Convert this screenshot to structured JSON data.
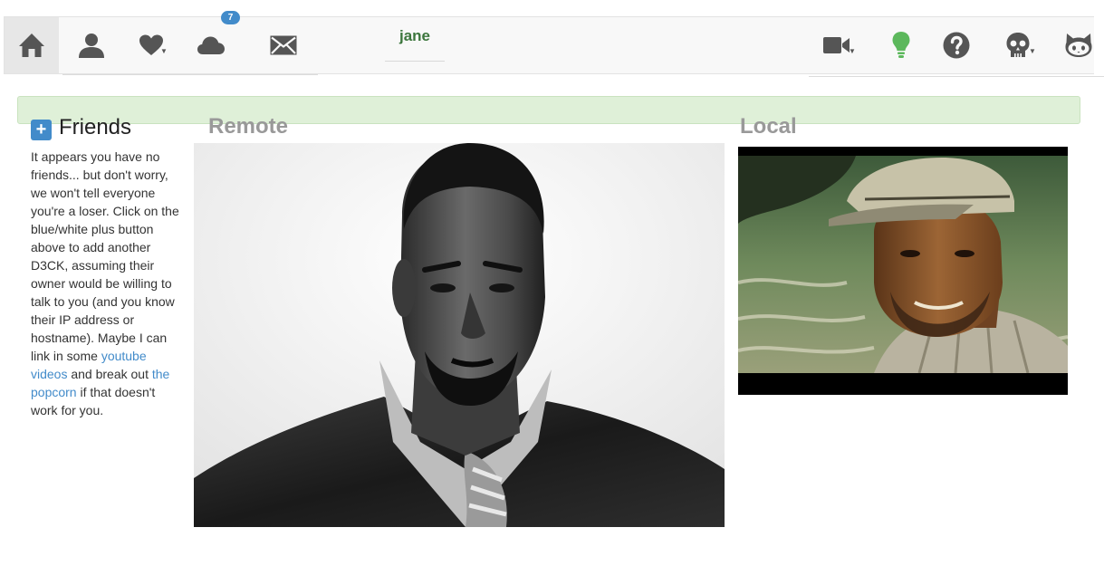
{
  "navbar": {
    "notification_count": "7",
    "username": "jane",
    "left_icons": [
      "home-icon",
      "user-icon",
      "heart-icon",
      "cloud-icon",
      "envelope-icon"
    ],
    "right_icons": [
      "video-camera-icon",
      "lightbulb-icon",
      "question-icon",
      "skull-icon",
      "github-cat-icon"
    ],
    "colors": {
      "bar": "#f8f8f8",
      "active": "#e7e7e7",
      "icon": "#555555",
      "badge": "#428bca",
      "username": "#3c763d",
      "bulb": "#5cb85c"
    }
  },
  "alert": {
    "color": "#dff0d8"
  },
  "friends": {
    "title": "Friends",
    "add_icon": "+",
    "text_1": "It appears you have no friends... but don't worry, we won't tell everyone you're a loser. Click on the blue/white plus button above to add another D3CK, assuming their owner would be willing to talk to you (and you know their IP address or hostname). Maybe I can link in some ",
    "link_1": "youtube videos",
    "text_2": " and break out ",
    "link_2": "the popcorn",
    "text_3": " if that doesn't work for you."
  },
  "panes": {
    "remote_label": "Remote",
    "local_label": "Local"
  }
}
